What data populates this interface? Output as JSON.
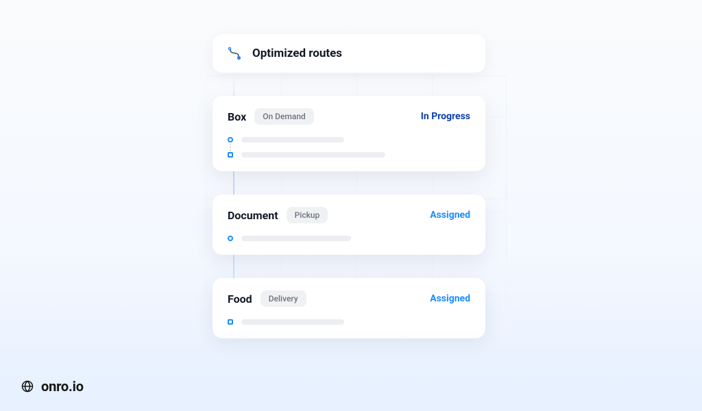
{
  "header": {
    "title": "Optimized routes"
  },
  "cards": [
    {
      "title": "Box",
      "chip": "On Demand",
      "status": {
        "label": "In Progress",
        "kind": "progress"
      },
      "stops": 2
    },
    {
      "title": "Document",
      "chip": "Pickup",
      "status": {
        "label": "Assigned",
        "kind": "assigned"
      },
      "stops": 1
    },
    {
      "title": "Food",
      "chip": "Delivery",
      "status": {
        "label": "Assigned",
        "kind": "assigned"
      },
      "stops": 1
    }
  ],
  "brand": {
    "text": "onro.io"
  },
  "colors": {
    "status_progress": "#0b3fa8",
    "status_assigned": "#1a8cff",
    "accent": "#1a8cff"
  }
}
